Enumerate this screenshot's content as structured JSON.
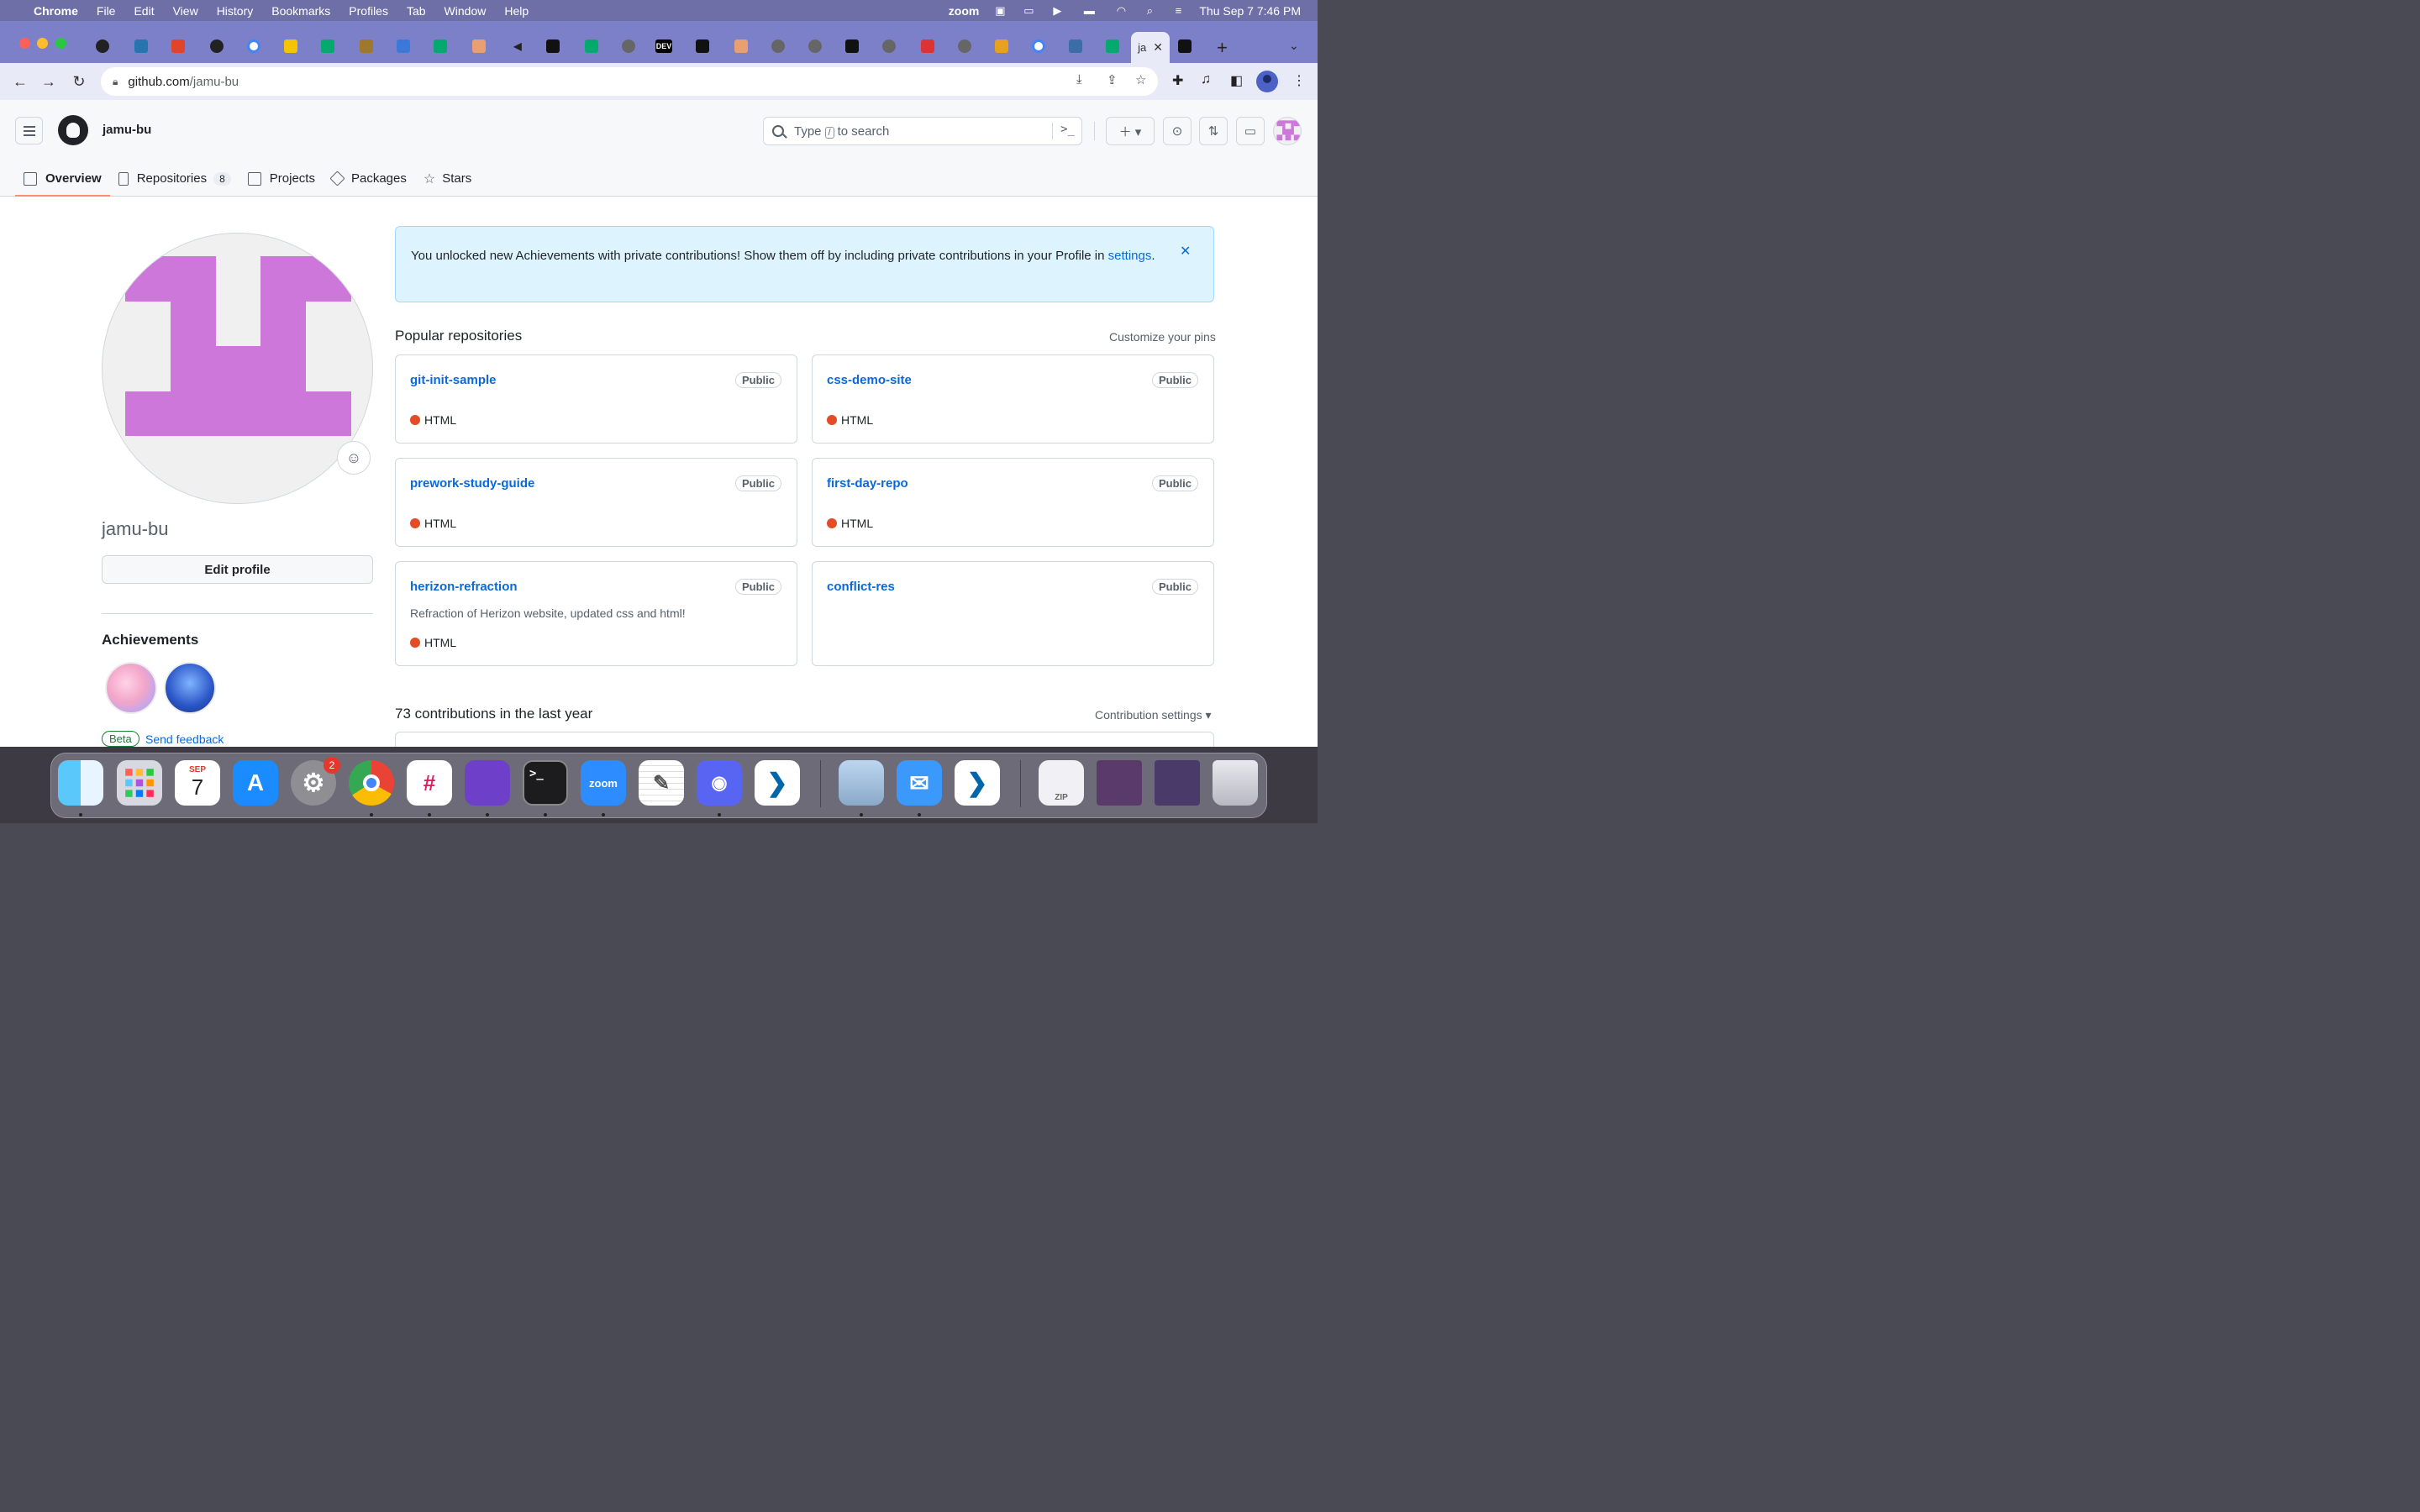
{
  "menubar": {
    "app": "Chrome",
    "items": [
      "File",
      "Edit",
      "View",
      "History",
      "Bookmarks",
      "Profiles",
      "Tab",
      "Window",
      "Help"
    ],
    "zoom_label": "zoom",
    "datetime": "Thu Sep 7  7:46 PM"
  },
  "browser": {
    "url_host": "github.com",
    "url_path": "/jamu-bu",
    "active_tab_label": "ja",
    "tab_labels": [
      "DEV"
    ]
  },
  "github": {
    "username": "jamu-bu",
    "search_prefix": "Type",
    "search_key": "/",
    "search_suffix": "to search",
    "nav": {
      "overview": "Overview",
      "repositories": "Repositories",
      "repositories_count": "8",
      "projects": "Projects",
      "packages": "Packages",
      "stars": "Stars"
    },
    "profile": {
      "display_username": "jamu-bu",
      "edit_profile": "Edit profile",
      "achievements_title": "Achievements",
      "beta": "Beta",
      "send_feedback": "Send feedback"
    },
    "flash": {
      "message": "You unlocked new Achievements with private contributions! Show them off by including private contributions in your Profile in ",
      "link": "settings",
      "end": "."
    },
    "popular": {
      "title": "Popular repositories",
      "customize": "Customize your pins",
      "repos": [
        {
          "name": "git-init-sample",
          "visibility": "Public",
          "language": "HTML",
          "description": ""
        },
        {
          "name": "css-demo-site",
          "visibility": "Public",
          "language": "HTML",
          "description": ""
        },
        {
          "name": "prework-study-guide",
          "visibility": "Public",
          "language": "HTML",
          "description": ""
        },
        {
          "name": "first-day-repo",
          "visibility": "Public",
          "language": "HTML",
          "description": ""
        },
        {
          "name": "herizon-refraction",
          "visibility": "Public",
          "language": "HTML",
          "description": "Refraction of Herizon website, updated css and html!"
        },
        {
          "name": "conflict-res",
          "visibility": "Public",
          "language": "",
          "description": ""
        }
      ]
    },
    "contributions": {
      "title": "73 contributions in the last year",
      "settings": "Contribution settings ▾"
    }
  },
  "dock": {
    "calendar_month": "SEP",
    "calendar_day": "7",
    "settings_badge": "2",
    "zoom_label": "zoom",
    "zip_label": "ZIP"
  },
  "colors": {
    "accent_link": "#0969da",
    "html_language": "#e34c26",
    "avatar_pink": "#cc77d9",
    "flash_bg": "#ddf4ff",
    "tab_strip": "#7c80c8"
  }
}
